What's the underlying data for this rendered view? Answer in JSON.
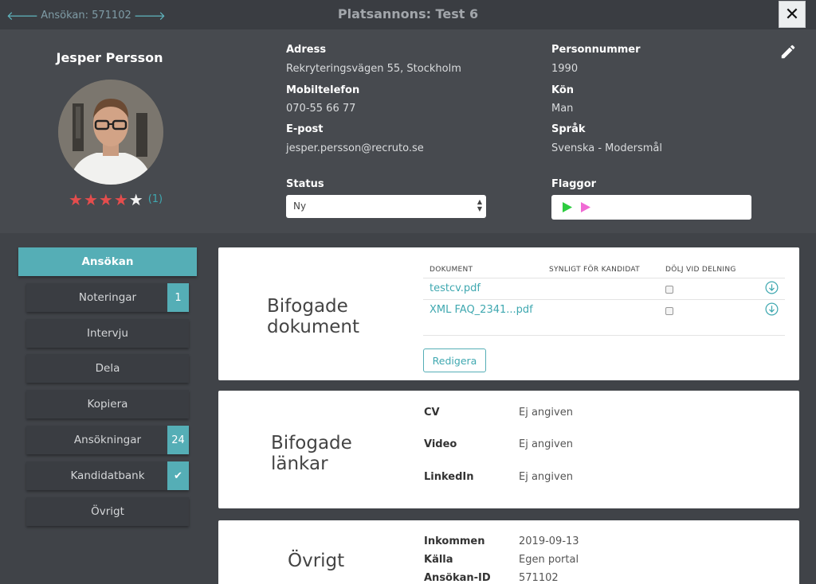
{
  "topbar": {
    "app_nav": "Ansökan: 571102",
    "title": "Platsannons: Test 6",
    "close_label": "✕"
  },
  "candidate": {
    "name": "Jesper Persson",
    "rating": 4,
    "rating_max": 5,
    "rating_count": "(1)"
  },
  "fields": {
    "address_label": "Adress",
    "address_value": "Rekryteringsvägen 55, Stockholm",
    "mobile_label": "Mobiltelefon",
    "mobile_value": "070-55 66 77",
    "email_label": "E-post",
    "email_value": "jesper.persson@recruto.se",
    "pnr_label": "Personnummer",
    "pnr_value": "1990",
    "gender_label": "Kön",
    "gender_value": "Man",
    "language_label": "Språk",
    "language_value": "Svenska - Modersmål",
    "status_label": "Status",
    "status_value": "Ny",
    "flags_label": "Flaggor"
  },
  "icons": {
    "edit": "pencil-icon",
    "flag1": "green-play-icon",
    "flag2": "pink-play-icon",
    "download": "download-circle-icon"
  },
  "colors": {
    "accent": "#55aeb6",
    "star": "#e44d4d",
    "flag_green": "#2ecc40",
    "flag_pink": "#f06ad4"
  },
  "menu": [
    {
      "label": "Ansökan",
      "badge": "",
      "active": true
    },
    {
      "label": "Noteringar",
      "badge": "1"
    },
    {
      "label": "Intervju",
      "badge": ""
    },
    {
      "label": "Dela",
      "badge": ""
    },
    {
      "label": "Kopiera",
      "badge": ""
    },
    {
      "label": "Ansökningar",
      "badge": "24"
    },
    {
      "label": "Kandidatbank",
      "badge": "✔"
    },
    {
      "label": "Övrigt",
      "badge": ""
    }
  ],
  "documents": {
    "title_line1": "Bifogade",
    "title_line2": "dokument",
    "col_document": "DOKUMENT",
    "col_visible": "SYNLIGT FÖR KANDIDAT",
    "col_hide": "DÖLJ VID DELNING",
    "rows": [
      {
        "name": "testcv.pdf"
      },
      {
        "name": "XML FAQ_2341...pdf"
      }
    ],
    "edit_button": "Redigera"
  },
  "links": {
    "title_line1": "Bifogade",
    "title_line2": "länkar",
    "rows": [
      {
        "label": "CV",
        "value": "Ej angiven"
      },
      {
        "label": "Video",
        "value": "Ej angiven"
      },
      {
        "label": "LinkedIn",
        "value": "Ej angiven"
      }
    ]
  },
  "other": {
    "title": "Övrigt",
    "rows": [
      {
        "label": "Inkommen",
        "value": "2019-09-13"
      },
      {
        "label": "Källa",
        "value": "Egen portal"
      },
      {
        "label": "Ansökan-ID",
        "value": "571102"
      }
    ]
  }
}
